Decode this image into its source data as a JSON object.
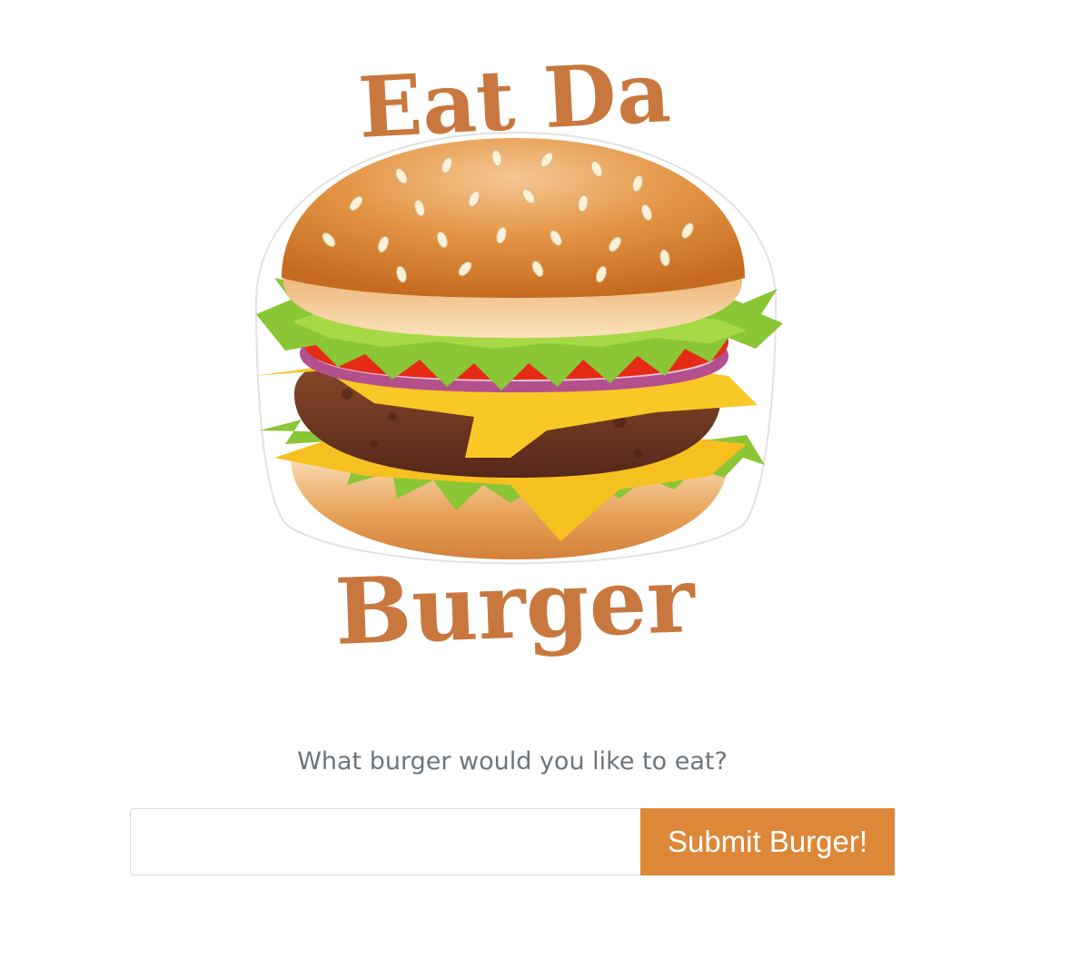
{
  "logo": {
    "top_word": "Eat Da",
    "bottom_word": "Burger",
    "colors": {
      "text": "#c8783e",
      "bun": "#e2913f",
      "cheese": "#f7c021",
      "lettuce": "#8ac635",
      "tomato": "#e52b16",
      "onion": "#b4508c",
      "patty": "#6a3520"
    }
  },
  "form": {
    "prompt": "What burger would you like to eat?",
    "input_value": "",
    "input_placeholder": "",
    "submit_label": "Submit Burger!"
  },
  "colors": {
    "accent": "#dd8838",
    "prompt_text": "#6c757d"
  }
}
